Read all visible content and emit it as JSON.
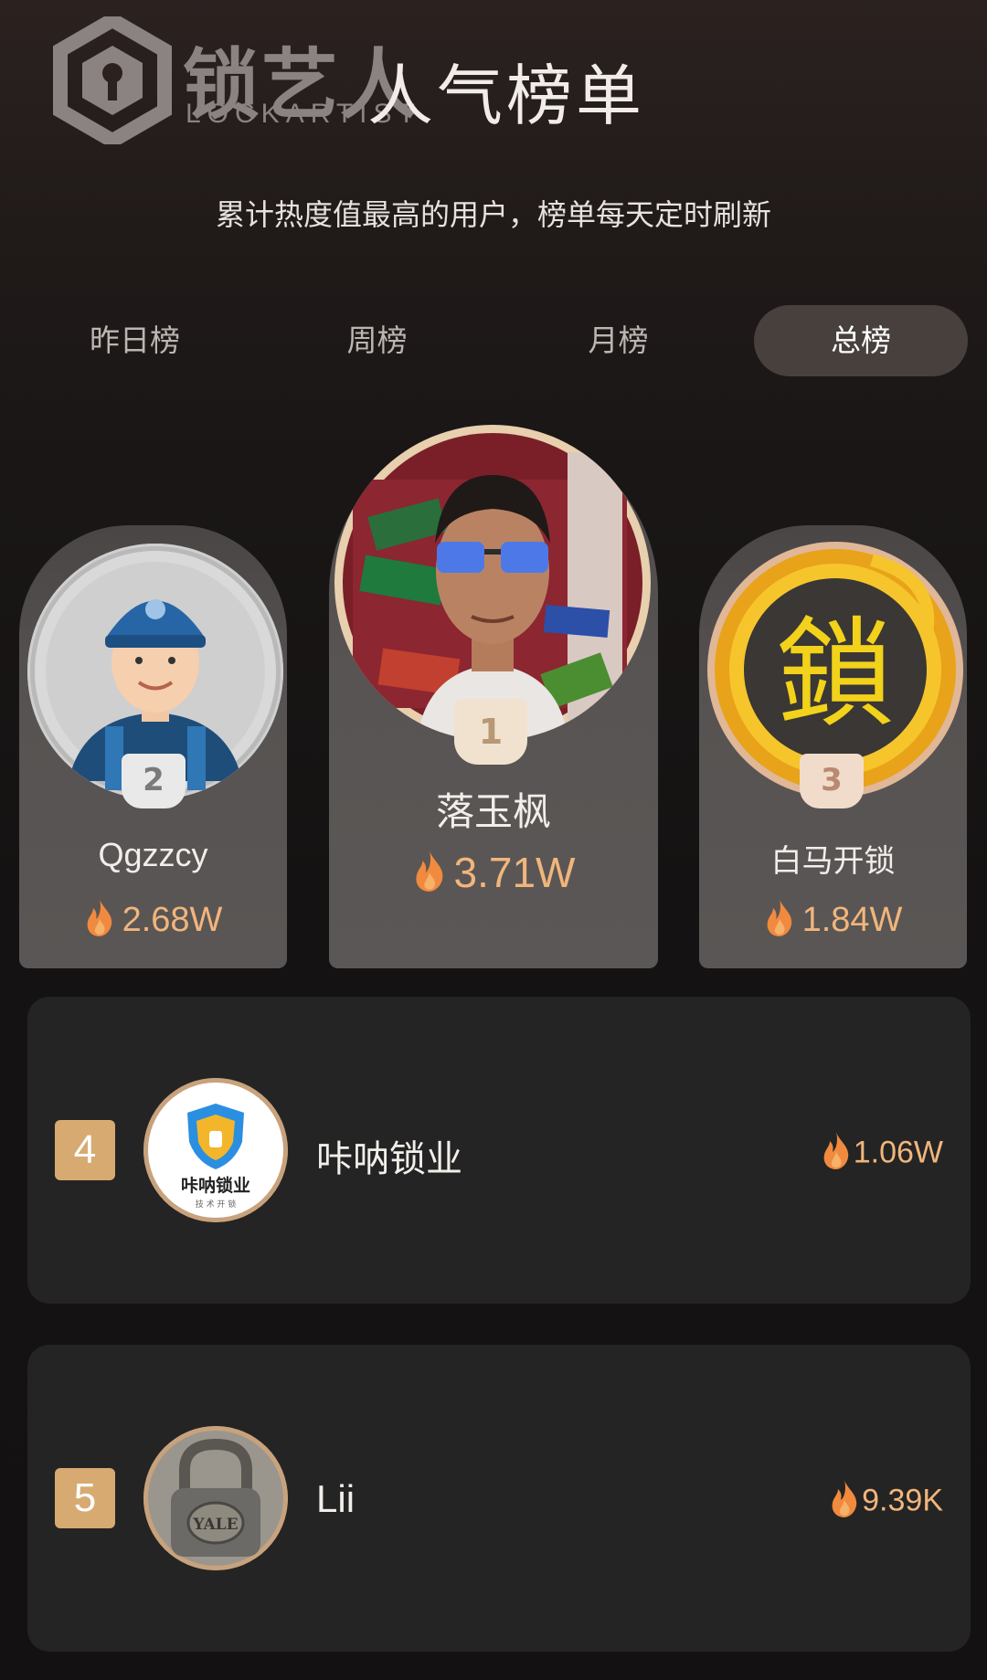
{
  "header": {
    "brand_cn": "锁艺人",
    "brand_en": "LOCKARTIST",
    "title": "人气榜单",
    "subtitle": "累计热度值最高的用户，榜单每天定时刷新"
  },
  "tabs": [
    {
      "label": "昨日榜",
      "active": false
    },
    {
      "label": "周榜",
      "active": false
    },
    {
      "label": "月榜",
      "active": false
    },
    {
      "label": "总榜",
      "active": true
    }
  ],
  "podium": {
    "first": {
      "rank": "1",
      "name": "落玉枫",
      "score": "3.71W"
    },
    "second": {
      "rank": "2",
      "name": "Qgzzcy",
      "score": "2.68W"
    },
    "third": {
      "rank": "3",
      "name": "白马开锁",
      "score": "1.84W"
    }
  },
  "list": [
    {
      "rank": "4",
      "name": "咔呐锁业",
      "score": "1.06W",
      "avatar_text": "咔呐锁业",
      "avatar_sub": "技 术 开 锁"
    },
    {
      "rank": "5",
      "name": "Lii",
      "score": "9.39K",
      "avatar_text": "YALE"
    }
  ],
  "colors": {
    "accent": "#f1b57c",
    "rank_box": "#d7aa72",
    "tab_active_bg": "#47403d",
    "card_bg": "#242424"
  },
  "icons": {
    "flame": "flame-icon",
    "logo": "lockartist-logo"
  }
}
